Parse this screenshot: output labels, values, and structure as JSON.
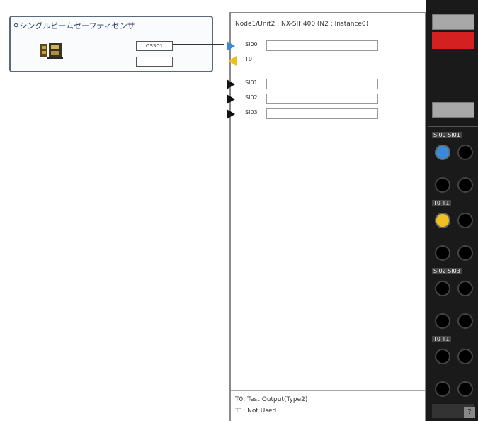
{
  "device": {
    "title": "シングルビームセーフティセンサ",
    "output_port": "OSSD1"
  },
  "unit": {
    "title": "Node1/Unit2 : NX-SIH400 (N2 : Instance0)",
    "inputs": [
      {
        "label": "SI00",
        "arrow": "blue"
      },
      {
        "label": "T0",
        "arrow": "yellow"
      },
      {
        "label": "SI01",
        "arrow": "black"
      },
      {
        "label": "SI02",
        "arrow": "black"
      },
      {
        "label": "SI03",
        "arrow": "black"
      }
    ],
    "footer": {
      "line1": "T0: Test Output(Type2)",
      "line2": "T1: Not Used"
    }
  },
  "terminal": {
    "labels": [
      "SI00 SI01",
      "T0 T1",
      "SI02 SI03",
      "T0 T1"
    ],
    "help": "?"
  },
  "colors": {
    "input_active": "#3a8ad8",
    "test_output": "#f0c020",
    "error_led": "#d42020"
  }
}
